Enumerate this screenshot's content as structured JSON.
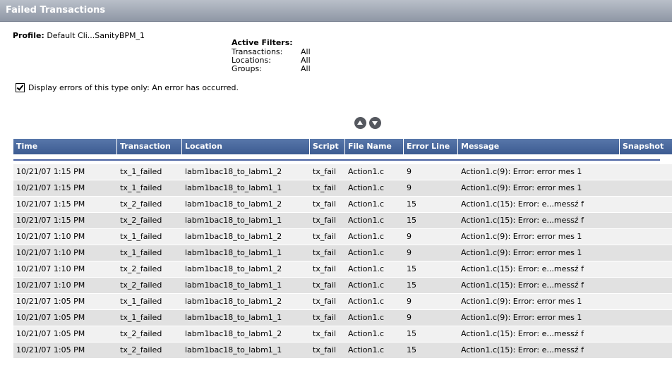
{
  "window": {
    "title": "Failed Transactions"
  },
  "profile": {
    "label": "Profile:",
    "value": "Default Cli...SanityBPM_1"
  },
  "filters": {
    "title": "Active Filters:",
    "items": [
      {
        "key": "Transactions:",
        "value": "All"
      },
      {
        "key": "Locations:",
        "value": "All"
      },
      {
        "key": "Groups:",
        "value": "All"
      }
    ]
  },
  "display_errors": {
    "checked": true,
    "label": "Display errors of this type only: An error has occurred."
  },
  "nav": {
    "up_icon": "arrow-up-circle-icon",
    "down_icon": "arrow-down-circle-icon"
  },
  "colors": {
    "header_bg": "#3c5b91",
    "title_bg": "#8f97a5",
    "row_odd": "#f1f1f1",
    "row_even": "#e1e1e1"
  },
  "table": {
    "columns": [
      "Time",
      "Transaction",
      "Location",
      "Script",
      "File Name",
      "Error Line",
      "Message",
      "Snapshot"
    ],
    "rows": [
      [
        "10/21/07 1:15 PM",
        "tx_1_failed",
        "labm1bac18_to_labm1_2",
        "tx_fail",
        "Action1.c",
        "9",
        "Action1.c(9): Error: error mes 1",
        ""
      ],
      [
        "10/21/07 1:15 PM",
        "tx_1_failed",
        "labm1bac18_to_labm1_1",
        "tx_fail",
        "Action1.c",
        "9",
        "Action1.c(9): Error: error mes 1",
        ""
      ],
      [
        "10/21/07 1:15 PM",
        "tx_2_failed",
        "labm1bac18_to_labm1_2",
        "tx_fail",
        "Action1.c",
        "15",
        "Action1.c(15): Error: e...messź f",
        ""
      ],
      [
        "10/21/07 1:15 PM",
        "tx_2_failed",
        "labm1bac18_to_labm1_1",
        "tx_fail",
        "Action1.c",
        "15",
        "Action1.c(15): Error: e...messź f",
        ""
      ],
      [
        "10/21/07 1:10 PM",
        "tx_1_failed",
        "labm1bac18_to_labm1_2",
        "tx_fail",
        "Action1.c",
        "9",
        "Action1.c(9): Error: error mes 1",
        ""
      ],
      [
        "10/21/07 1:10 PM",
        "tx_1_failed",
        "labm1bac18_to_labm1_1",
        "tx_fail",
        "Action1.c",
        "9",
        "Action1.c(9): Error: error mes 1",
        ""
      ],
      [
        "10/21/07 1:10 PM",
        "tx_2_failed",
        "labm1bac18_to_labm1_2",
        "tx_fail",
        "Action1.c",
        "15",
        "Action1.c(15): Error: e...messź f",
        ""
      ],
      [
        "10/21/07 1:10 PM",
        "tx_2_failed",
        "labm1bac18_to_labm1_1",
        "tx_fail",
        "Action1.c",
        "15",
        "Action1.c(15): Error: e...messź f",
        ""
      ],
      [
        "10/21/07 1:05 PM",
        "tx_1_failed",
        "labm1bac18_to_labm1_2",
        "tx_fail",
        "Action1.c",
        "9",
        "Action1.c(9): Error: error mes 1",
        ""
      ],
      [
        "10/21/07 1:05 PM",
        "tx_1_failed",
        "labm1bac18_to_labm1_1",
        "tx_fail",
        "Action1.c",
        "9",
        "Action1.c(9): Error: error mes 1",
        ""
      ],
      [
        "10/21/07 1:05 PM",
        "tx_2_failed",
        "labm1bac18_to_labm1_2",
        "tx_fail",
        "Action1.c",
        "15",
        "Action1.c(15): Error: e...messź f",
        ""
      ],
      [
        "10/21/07 1:05 PM",
        "tx_2_failed",
        "labm1bac18_to_labm1_1",
        "tx_fail",
        "Action1.c",
        "15",
        "Action1.c(15): Error: e...messź f",
        ""
      ]
    ]
  }
}
